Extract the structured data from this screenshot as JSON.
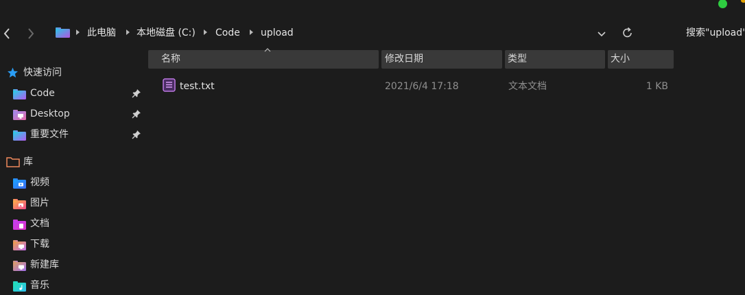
{
  "toolbar": {
    "back_label": "",
    "forward_label": ""
  },
  "breadcrumb": {
    "items": [
      "此电脑",
      "本地磁盘 (C:)",
      "Code",
      "upload"
    ]
  },
  "search": {
    "placeholder": "搜索\"upload\""
  },
  "columns": {
    "name": "名称",
    "modified": "修改日期",
    "type": "类型",
    "size": "大小"
  },
  "files": [
    {
      "name": "test.txt",
      "modified": "2021/6/4 17:18",
      "type": "文本文档",
      "size": "1 KB"
    }
  ],
  "sidebar": {
    "quick_access": "快速访问",
    "pinned": [
      {
        "label": "Code",
        "icon": "folder-icon"
      },
      {
        "label": "Desktop",
        "icon": "desktop-folder-icon"
      },
      {
        "label": "重要文件",
        "icon": "folder-icon"
      }
    ],
    "library": "库",
    "libraries": [
      {
        "label": "视频",
        "icon": "video-folder-icon"
      },
      {
        "label": "图片",
        "icon": "pictures-folder-icon"
      },
      {
        "label": "文档",
        "icon": "documents-folder-icon"
      },
      {
        "label": "下载",
        "icon": "downloads-folder-icon"
      },
      {
        "label": "新建库",
        "icon": "library-folder-icon"
      },
      {
        "label": "音乐",
        "icon": "music-folder-icon"
      }
    ]
  },
  "colors": {
    "background": "#1c1c1c",
    "header_bg": "#393939",
    "accent_star": "#2a9df4",
    "status_dot": "#2ecc40"
  }
}
